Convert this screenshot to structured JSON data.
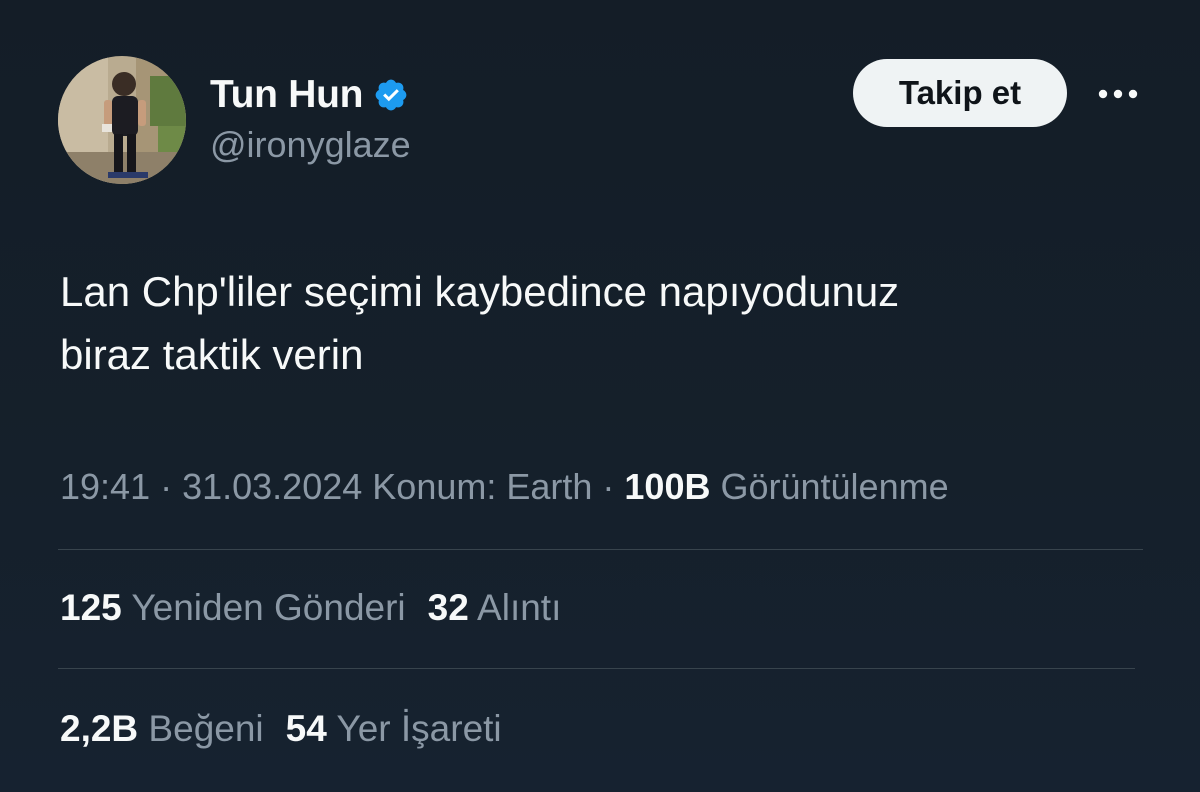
{
  "author": {
    "display_name": "Tun Hun",
    "handle": "@ironyglaze",
    "verified": true
  },
  "actions": {
    "follow_label": "Takip et"
  },
  "tweet": {
    "text": "Lan Chp'liler seçimi kaybedince napıyodunuz\nbiraz taktik verin"
  },
  "meta": {
    "time": "19:41",
    "sep1": " · ",
    "date": "31.03.2024",
    "location": " Konum: Earth",
    "sep2": " · ",
    "views_count": "100B",
    "views_label": " Görüntülenme"
  },
  "stats": {
    "reposts_count": "125",
    "reposts_label": " Yeniden Gönderi",
    "quotes_count": "32",
    "quotes_label": " Alıntı",
    "likes_count": "2,2B",
    "likes_label": " Beğeni",
    "bookmarks_count": "54",
    "bookmarks_label": " Yer İşareti"
  },
  "icons": {
    "verified": "verified-badge-icon",
    "more": "more-horizontal-icon"
  },
  "colors": {
    "background": "#15202b",
    "text": "#f7f9f9",
    "secondary_text": "#8b98a5",
    "verified_blue": "#1d9bf0",
    "follow_button_bg": "#eff3f4",
    "divider": "#38444d"
  }
}
